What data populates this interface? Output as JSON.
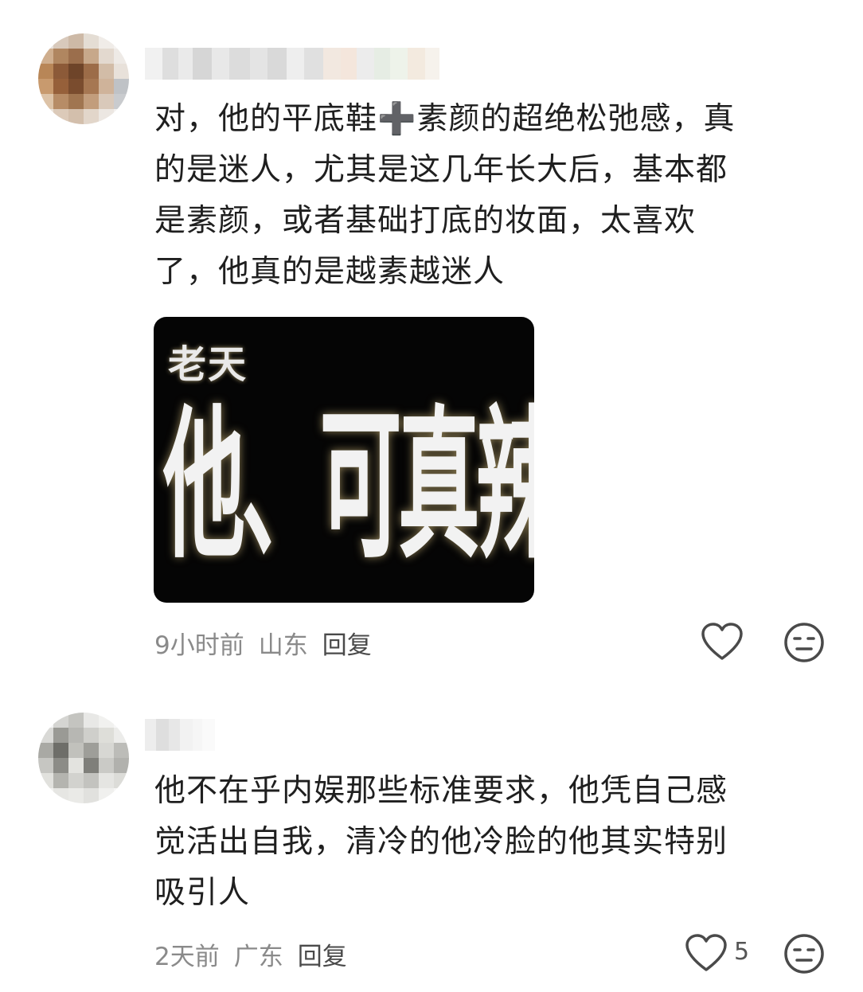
{
  "comments": [
    {
      "text": "对，他的平底鞋➕素颜的超绝松弛感，真\n的是迷人，尤其是这几年长大后，基本都\n是素颜，或者基础打底的妆面，太喜欢\n了，他真的是越素越迷人",
      "sticker": {
        "small_text": "老天",
        "big_text": "他、可真辣"
      },
      "time": "9小时前",
      "location": "山东",
      "reply_label": "回复",
      "likes": ""
    },
    {
      "text": "他不在乎内娱那些标准要求，他凭自己感\n觉活出自我，清冷的他冷脸的他其实特别\n吸引人",
      "time": "2天前",
      "location": "广东",
      "reply_label": "回复",
      "likes": "5"
    }
  ],
  "icons": {
    "like": "heart-icon",
    "dislike": "neutral-face-icon"
  },
  "colors": {
    "text": "#1f1f1f",
    "meta": "#8a8a8a",
    "icon": "#4a4a4a"
  }
}
